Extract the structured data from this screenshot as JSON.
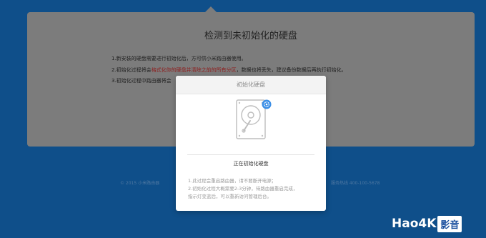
{
  "background_page": {
    "title": "检测到未初始化的硬盘",
    "lines": [
      {
        "text": "1.新安装的硬盘需要进行初始化后，方可供小米路由器使用。"
      },
      {
        "pre": "2.初始化过程将会",
        "warn": "格式化你的硬盘并清除之前的所有分区",
        "post": "，数据也将丢失，建议备份数据后再执行初始化。"
      },
      {
        "text": "3.初始化过程中路由器将会"
      }
    ],
    "footer_left": "© 2015 小米路由器",
    "footer_right": "服务热线 400-100-5678"
  },
  "modal": {
    "title": "初始化硬盘",
    "status": "正在初始化硬盘",
    "notes": [
      "1.此过程会重启路由器，请不要断开电源；",
      "2.初始化过程大概需要2-3分钟，待路由器重启完成，",
      "指示灯变蓝后，可以重新访问管理后台。"
    ],
    "icon": "hard-disk-icon",
    "badge_icon": "gear-icon"
  },
  "watermark": {
    "main": "Hao4K",
    "sub": "影音"
  },
  "colors": {
    "page_background": "#0f4f8a",
    "overlay_card": "#7c7c7c",
    "warning_text": "#8e1b1b",
    "badge_blue": "#3a8ee6"
  }
}
